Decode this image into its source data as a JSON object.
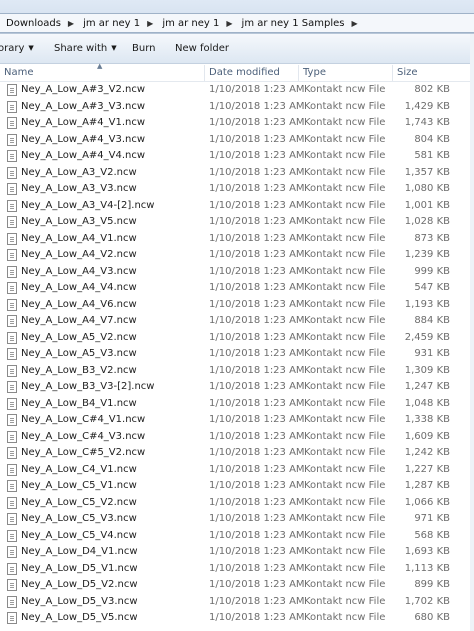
{
  "address": {
    "crumbs": [
      "Downloads",
      "jm ar ney 1",
      "jm ar ney 1",
      "jm ar ney 1 Samples"
    ]
  },
  "toolbar": {
    "library_label": "orary",
    "share_label": "Share with",
    "burn_label": "Burn",
    "new_folder_label": "New folder"
  },
  "columns": {
    "name": "Name",
    "date": "Date modified",
    "type": "Type",
    "size": "Size"
  },
  "files": [
    {
      "name": "Ney_A_Low_A#3_V2.ncw",
      "date": "1/10/2018 1:23 AM",
      "type": "Kontakt ncw File",
      "size": "802 KB"
    },
    {
      "name": "Ney_A_Low_A#3_V3.ncw",
      "date": "1/10/2018 1:23 AM",
      "type": "Kontakt ncw File",
      "size": "1,429 KB"
    },
    {
      "name": "Ney_A_Low_A#4_V1.ncw",
      "date": "1/10/2018 1:23 AM",
      "type": "Kontakt ncw File",
      "size": "1,743 KB"
    },
    {
      "name": "Ney_A_Low_A#4_V3.ncw",
      "date": "1/10/2018 1:23 AM",
      "type": "Kontakt ncw File",
      "size": "804 KB"
    },
    {
      "name": "Ney_A_Low_A#4_V4.ncw",
      "date": "1/10/2018 1:23 AM",
      "type": "Kontakt ncw File",
      "size": "581 KB"
    },
    {
      "name": "Ney_A_Low_A3_V2.ncw",
      "date": "1/10/2018 1:23 AM",
      "type": "Kontakt ncw File",
      "size": "1,357 KB"
    },
    {
      "name": "Ney_A_Low_A3_V3.ncw",
      "date": "1/10/2018 1:23 AM",
      "type": "Kontakt ncw File",
      "size": "1,080 KB"
    },
    {
      "name": "Ney_A_Low_A3_V4-[2].ncw",
      "date": "1/10/2018 1:23 AM",
      "type": "Kontakt ncw File",
      "size": "1,001 KB"
    },
    {
      "name": "Ney_A_Low_A3_V5.ncw",
      "date": "1/10/2018 1:23 AM",
      "type": "Kontakt ncw File",
      "size": "1,028 KB"
    },
    {
      "name": "Ney_A_Low_A4_V1.ncw",
      "date": "1/10/2018 1:23 AM",
      "type": "Kontakt ncw File",
      "size": "873 KB"
    },
    {
      "name": "Ney_A_Low_A4_V2.ncw",
      "date": "1/10/2018 1:23 AM",
      "type": "Kontakt ncw File",
      "size": "1,239 KB"
    },
    {
      "name": "Ney_A_Low_A4_V3.ncw",
      "date": "1/10/2018 1:23 AM",
      "type": "Kontakt ncw File",
      "size": "999 KB"
    },
    {
      "name": "Ney_A_Low_A4_V4.ncw",
      "date": "1/10/2018 1:23 AM",
      "type": "Kontakt ncw File",
      "size": "547 KB"
    },
    {
      "name": "Ney_A_Low_A4_V6.ncw",
      "date": "1/10/2018 1:23 AM",
      "type": "Kontakt ncw File",
      "size": "1,193 KB"
    },
    {
      "name": "Ney_A_Low_A4_V7.ncw",
      "date": "1/10/2018 1:23 AM",
      "type": "Kontakt ncw File",
      "size": "884 KB"
    },
    {
      "name": "Ney_A_Low_A5_V2.ncw",
      "date": "1/10/2018 1:23 AM",
      "type": "Kontakt ncw File",
      "size": "2,459 KB"
    },
    {
      "name": "Ney_A_Low_A5_V3.ncw",
      "date": "1/10/2018 1:23 AM",
      "type": "Kontakt ncw File",
      "size": "931 KB"
    },
    {
      "name": "Ney_A_Low_B3_V2.ncw",
      "date": "1/10/2018 1:23 AM",
      "type": "Kontakt ncw File",
      "size": "1,309 KB"
    },
    {
      "name": "Ney_A_Low_B3_V3-[2].ncw",
      "date": "1/10/2018 1:23 AM",
      "type": "Kontakt ncw File",
      "size": "1,247 KB"
    },
    {
      "name": "Ney_A_Low_B4_V1.ncw",
      "date": "1/10/2018 1:23 AM",
      "type": "Kontakt ncw File",
      "size": "1,048 KB"
    },
    {
      "name": "Ney_A_Low_C#4_V1.ncw",
      "date": "1/10/2018 1:23 AM",
      "type": "Kontakt ncw File",
      "size": "1,338 KB"
    },
    {
      "name": "Ney_A_Low_C#4_V3.ncw",
      "date": "1/10/2018 1:23 AM",
      "type": "Kontakt ncw File",
      "size": "1,609 KB"
    },
    {
      "name": "Ney_A_Low_C#5_V2.ncw",
      "date": "1/10/2018 1:23 AM",
      "type": "Kontakt ncw File",
      "size": "1,242 KB"
    },
    {
      "name": "Ney_A_Low_C4_V1.ncw",
      "date": "1/10/2018 1:23 AM",
      "type": "Kontakt ncw File",
      "size": "1,227 KB"
    },
    {
      "name": "Ney_A_Low_C5_V1.ncw",
      "date": "1/10/2018 1:23 AM",
      "type": "Kontakt ncw File",
      "size": "1,287 KB"
    },
    {
      "name": "Ney_A_Low_C5_V2.ncw",
      "date": "1/10/2018 1:23 AM",
      "type": "Kontakt ncw File",
      "size": "1,066 KB"
    },
    {
      "name": "Ney_A_Low_C5_V3.ncw",
      "date": "1/10/2018 1:23 AM",
      "type": "Kontakt ncw File",
      "size": "971 KB"
    },
    {
      "name": "Ney_A_Low_C5_V4.ncw",
      "date": "1/10/2018 1:23 AM",
      "type": "Kontakt ncw File",
      "size": "568 KB"
    },
    {
      "name": "Ney_A_Low_D4_V1.ncw",
      "date": "1/10/2018 1:23 AM",
      "type": "Kontakt ncw File",
      "size": "1,693 KB"
    },
    {
      "name": "Ney_A_Low_D5_V1.ncw",
      "date": "1/10/2018 1:23 AM",
      "type": "Kontakt ncw File",
      "size": "1,113 KB"
    },
    {
      "name": "Ney_A_Low_D5_V2.ncw",
      "date": "1/10/2018 1:23 AM",
      "type": "Kontakt ncw File",
      "size": "899 KB"
    },
    {
      "name": "Ney_A_Low_D5_V3.ncw",
      "date": "1/10/2018 1:23 AM",
      "type": "Kontakt ncw File",
      "size": "1,702 KB"
    },
    {
      "name": "Ney_A_Low_D5_V5.ncw",
      "date": "1/10/2018 1:23 AM",
      "type": "Kontakt ncw File",
      "size": "680 KB"
    }
  ]
}
